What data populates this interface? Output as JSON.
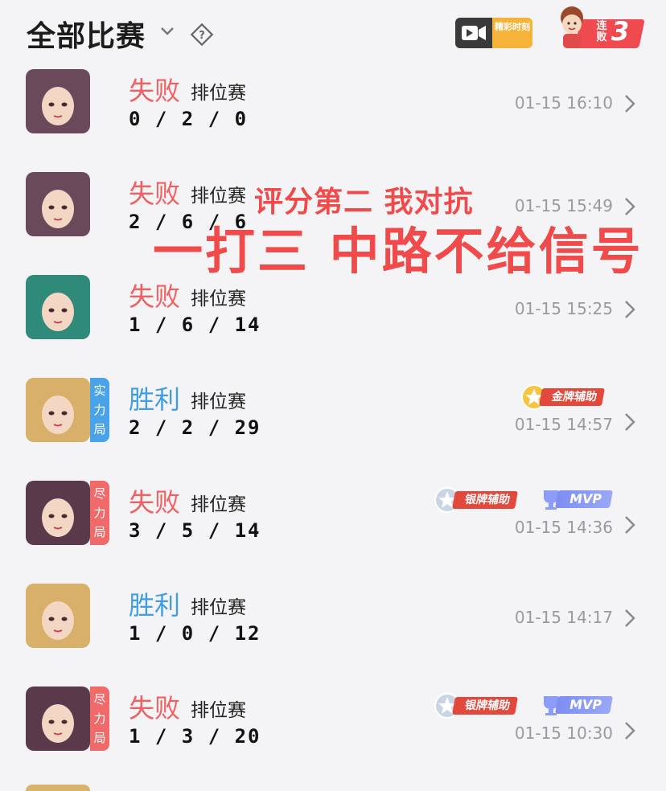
{
  "header": {
    "title": "全部比赛",
    "highlights_label": "精彩时刻",
    "streak_label": "连败",
    "streak_count": "3"
  },
  "overlay": {
    "line1": "评分第二 我对抗",
    "line2": "一打三 中路不给信号"
  },
  "matches": [
    {
      "result": "失败",
      "result_type": "lose",
      "mode": "排位赛",
      "kda": "0/2/0",
      "time": "01-15 16:10",
      "hero_color": "#6a4a5a"
    },
    {
      "result": "失败",
      "result_type": "lose",
      "mode": "排位赛",
      "kda": "2/6/6",
      "time": "01-15 15:49",
      "hero_color": "#6a4a5a"
    },
    {
      "result": "失败",
      "result_type": "lose",
      "mode": "排位赛",
      "kda": "1/6/14",
      "time": "01-15 15:25",
      "hero_color": "#2f8a7a"
    },
    {
      "result": "胜利",
      "result_type": "win",
      "mode": "排位赛",
      "kda": "2/2/29",
      "time": "01-15 14:57",
      "hero_color": "#d8b06a",
      "side_tag": "实力局",
      "side_tag_color": "#4aa3e8",
      "badge": "金牌辅助"
    },
    {
      "result": "失败",
      "result_type": "lose",
      "mode": "排位赛",
      "kda": "3/5/14",
      "time": "01-15 14:36",
      "hero_color": "#5a3a4a",
      "side_tag": "尽力局",
      "side_tag_color": "#f06a6a",
      "badge": "银牌辅助",
      "mvp": "MVP"
    },
    {
      "result": "胜利",
      "result_type": "win",
      "mode": "排位赛",
      "kda": "1/0/12",
      "time": "01-15 14:17",
      "hero_color": "#d8b06a"
    },
    {
      "result": "失败",
      "result_type": "lose",
      "mode": "排位赛",
      "kda": "1/3/20",
      "time": "01-15 10:30",
      "hero_color": "#5a3a4a",
      "side_tag": "尽力局",
      "side_tag_color": "#f06a6a",
      "badge": "银牌辅助",
      "mvp": "MVP"
    }
  ]
}
